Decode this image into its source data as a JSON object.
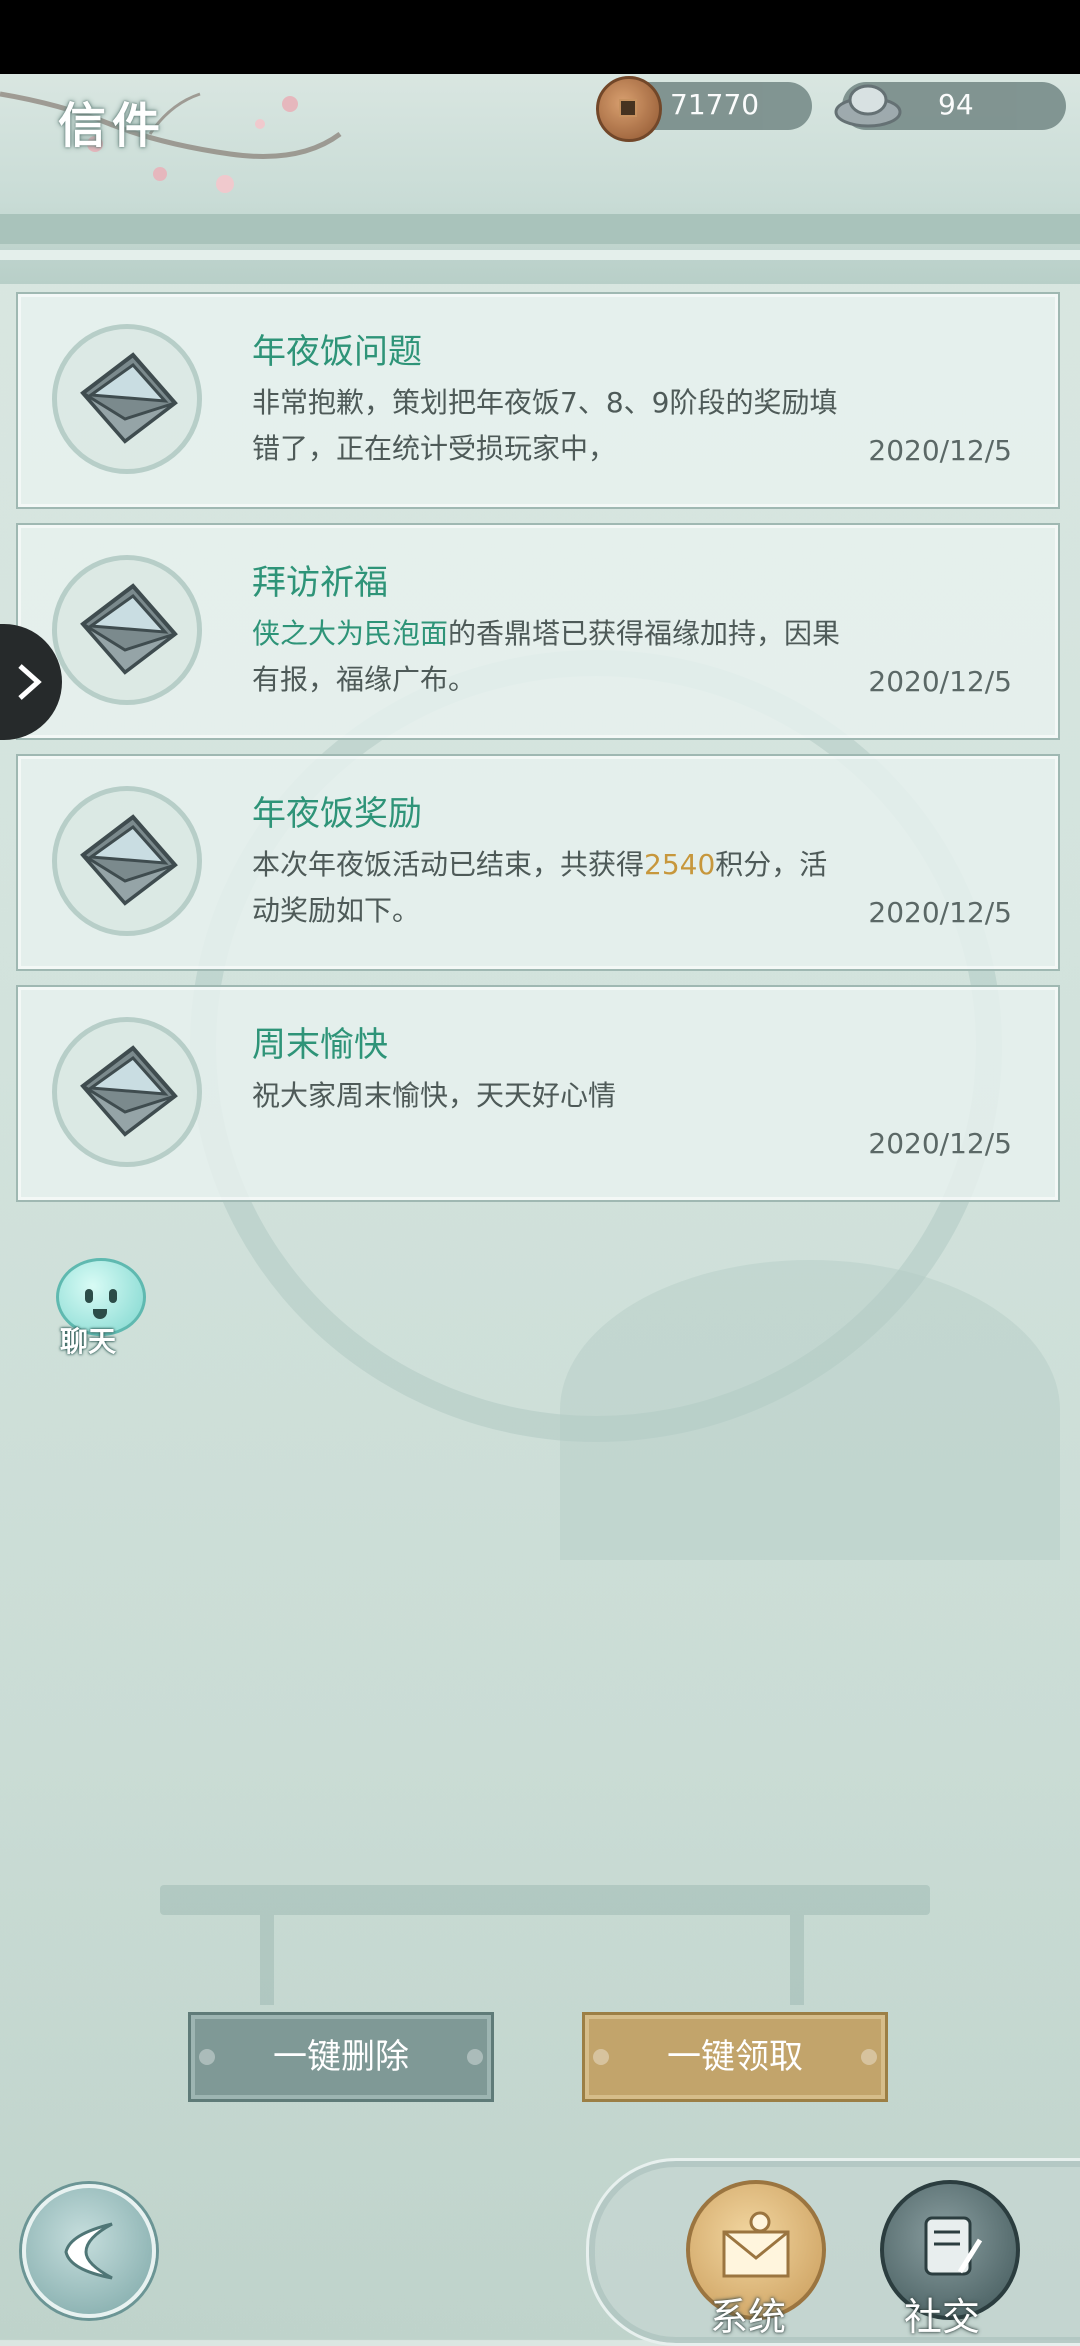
{
  "header": {
    "title": "信件",
    "copper": "71770",
    "silver": "94"
  },
  "mails": [
    {
      "title": "年夜饭问题",
      "body_parts": [
        {
          "text": "非常抱歉，策划把年夜饭7、8、9阶段的奖励填错了，正在统计受损玩家中，",
          "style": "normal"
        }
      ],
      "date": "2020/12/5"
    },
    {
      "title": "拜访祈福",
      "body_parts": [
        {
          "text": "侠之大为民泡面",
          "style": "green"
        },
        {
          "text": "的香鼎塔已获得福缘加持，因果有报，福缘广布。",
          "style": "normal"
        }
      ],
      "date": "2020/12/5"
    },
    {
      "title": "年夜饭奖励",
      "body_parts": [
        {
          "text": "本次年夜饭活动已结束，共获得",
          "style": "normal"
        },
        {
          "text": "2540",
          "style": "gold"
        },
        {
          "text": "积分，活动奖励如下。",
          "style": "normal"
        }
      ],
      "date": "2020/12/5"
    },
    {
      "title": "周末愉快",
      "body_parts": [
        {
          "text": "祝大家周末愉快，天天好心情",
          "style": "normal"
        }
      ],
      "date": "2020/12/5"
    }
  ],
  "chat": {
    "label": "聊天"
  },
  "actions": {
    "delete_all": "一键删除",
    "claim_all": "一键领取"
  },
  "dock": {
    "system_label": "系统",
    "social_label": "社交"
  },
  "colors": {
    "accent_green": "#2e9478",
    "accent_gold": "#c7973c"
  }
}
